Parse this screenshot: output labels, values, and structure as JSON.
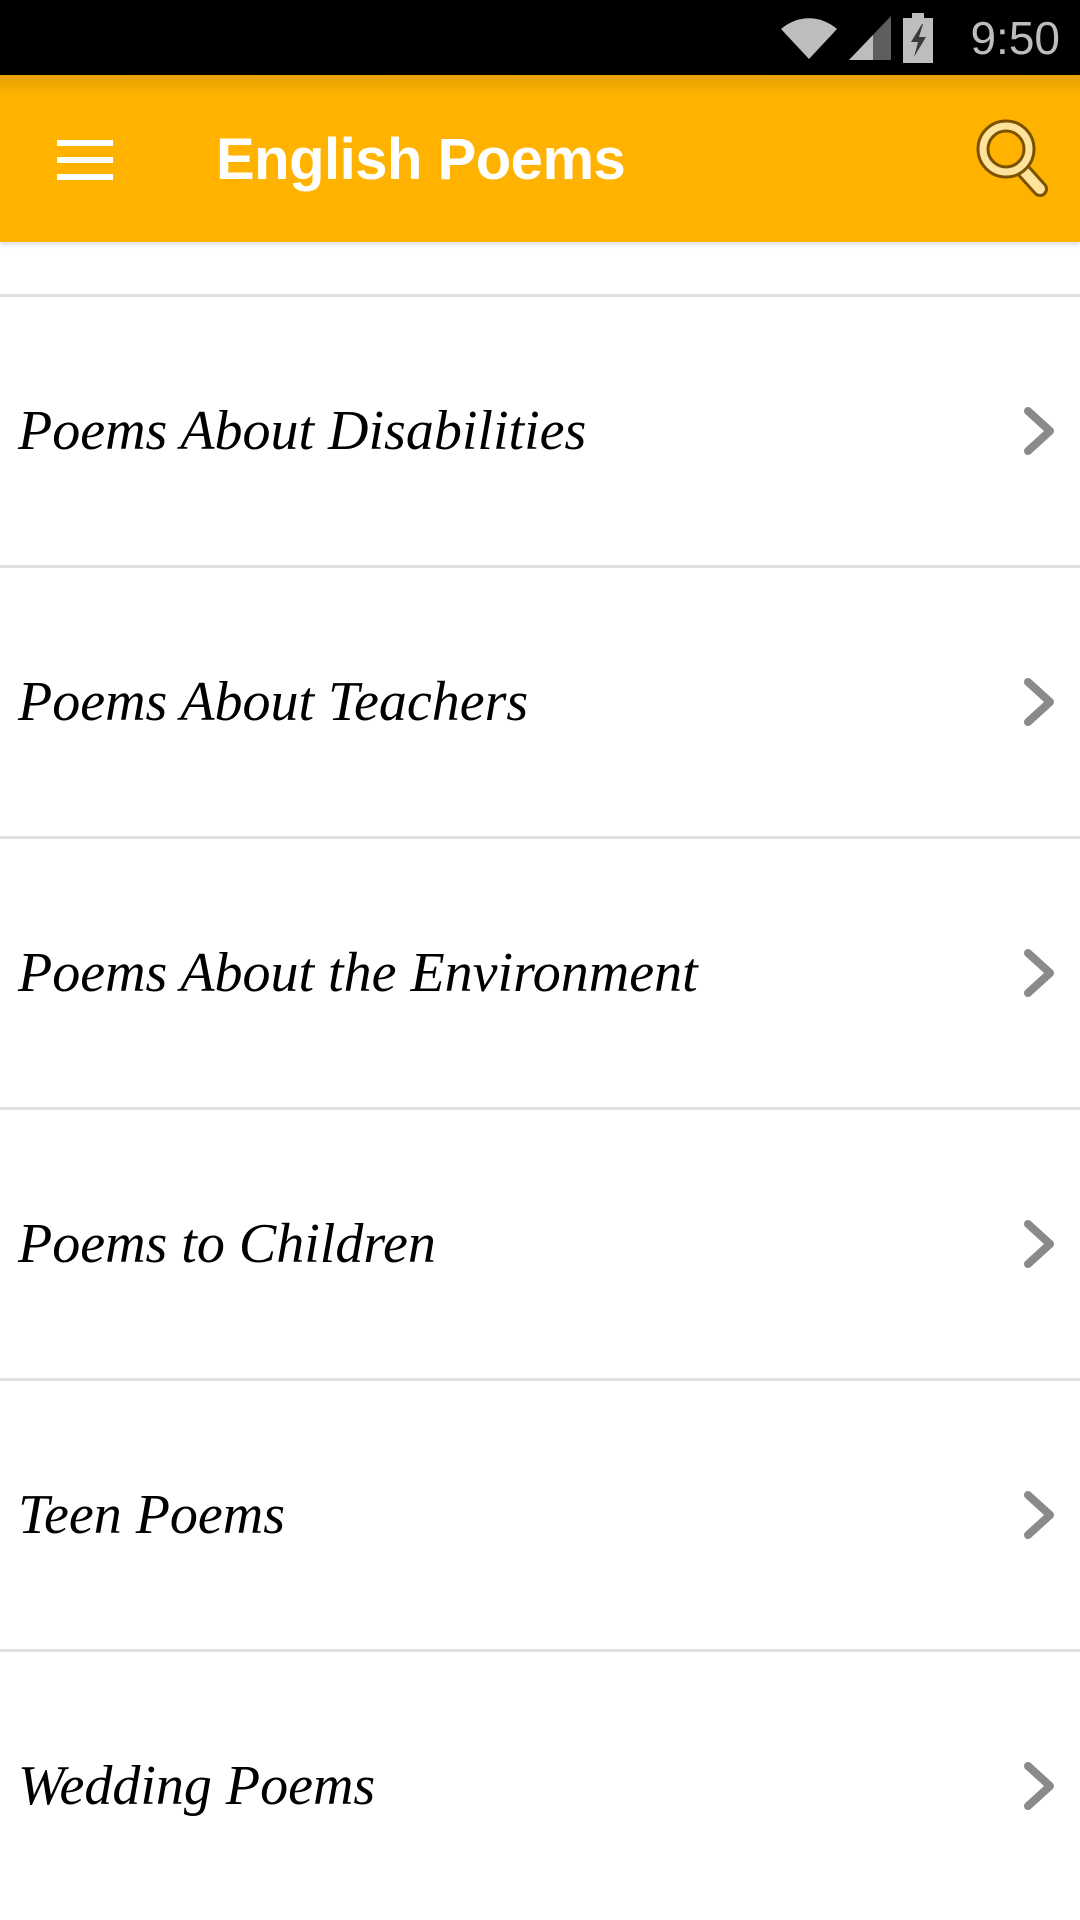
{
  "status_bar": {
    "time": "9:50",
    "icons": [
      "wifi-icon",
      "cell-signal-icon",
      "battery-charging-icon"
    ]
  },
  "toolbar": {
    "menu_icon": "hamburger-menu-icon",
    "title": "English Poems",
    "search_icon": "magnifier-icon",
    "background_color": "#FFB300"
  },
  "list": {
    "items": [
      {
        "label": "Poems About Disabilities",
        "icon": "chevron-right-icon"
      },
      {
        "label": "Poems About Teachers",
        "icon": "chevron-right-icon"
      },
      {
        "label": "Poems About the Environment",
        "icon": "chevron-right-icon"
      },
      {
        "label": "Poems to Children",
        "icon": "chevron-right-icon"
      },
      {
        "label": "Teen Poems",
        "icon": "chevron-right-icon"
      },
      {
        "label": "Wedding Poems",
        "icon": "chevron-right-icon"
      }
    ]
  }
}
